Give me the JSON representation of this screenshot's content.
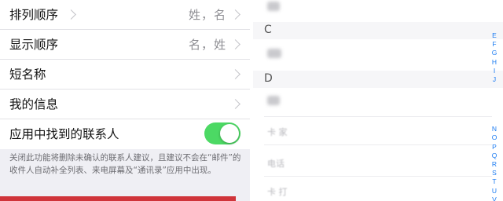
{
  "settings": {
    "rows": [
      {
        "label": "排列顺序",
        "value": "姓，名"
      },
      {
        "label": "显示顺序",
        "value": "名，姓"
      },
      {
        "label": "短名称",
        "value": ""
      },
      {
        "label": "我的信息",
        "value": ""
      },
      {
        "label": "应用中找到的联系人",
        "value": ""
      }
    ],
    "toggle_on": true,
    "note": "关闭此功能将删除未确认的联系人建议，且建议不会在“邮件”的收件人自动补全列表、来电屏幕及“通讯录”应用中出现。"
  },
  "contacts": {
    "sections": [
      {
        "letter": "C"
      },
      {
        "letter": "D"
      }
    ],
    "blurred_texts": [
      "卡 家",
      "电话",
      "卡 打"
    ]
  },
  "index": {
    "group1": [
      "E",
      "F",
      "G",
      "H",
      "I",
      "J"
    ],
    "group2": [
      "N",
      "O",
      "P",
      "Q",
      "R",
      "S",
      "T",
      "U",
      "V"
    ]
  },
  "colors": {
    "toggle": "#4cd964",
    "index": "#1a7bf2",
    "accent_bar": "#d0343a"
  }
}
